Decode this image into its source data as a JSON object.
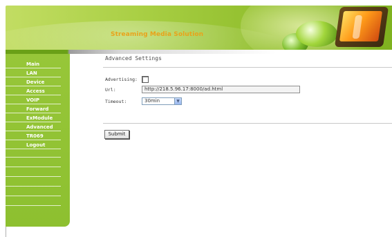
{
  "header": {
    "title": "Streaming Media Solution"
  },
  "sidebar": {
    "items": [
      {
        "label": "Main"
      },
      {
        "label": "LAN"
      },
      {
        "label": "Device"
      },
      {
        "label": "Access"
      },
      {
        "label": "VOIP"
      },
      {
        "label": "Forward"
      },
      {
        "label": "ExModule"
      },
      {
        "label": "Advanced"
      },
      {
        "label": "TR069"
      },
      {
        "label": "Logout"
      }
    ]
  },
  "page": {
    "title": "Advanced Settings"
  },
  "form": {
    "advertising_label": "Advertising:",
    "advertising_checked": false,
    "url_label": "Url:",
    "url_value": "http://218.5.96.17:8000/ad.html",
    "timeout_label": "Timeout:",
    "timeout_value": "30min",
    "submit_label": "Submit"
  },
  "colors": {
    "sidebar_green": "#8dc030",
    "banner_title": "#e9a21a"
  }
}
